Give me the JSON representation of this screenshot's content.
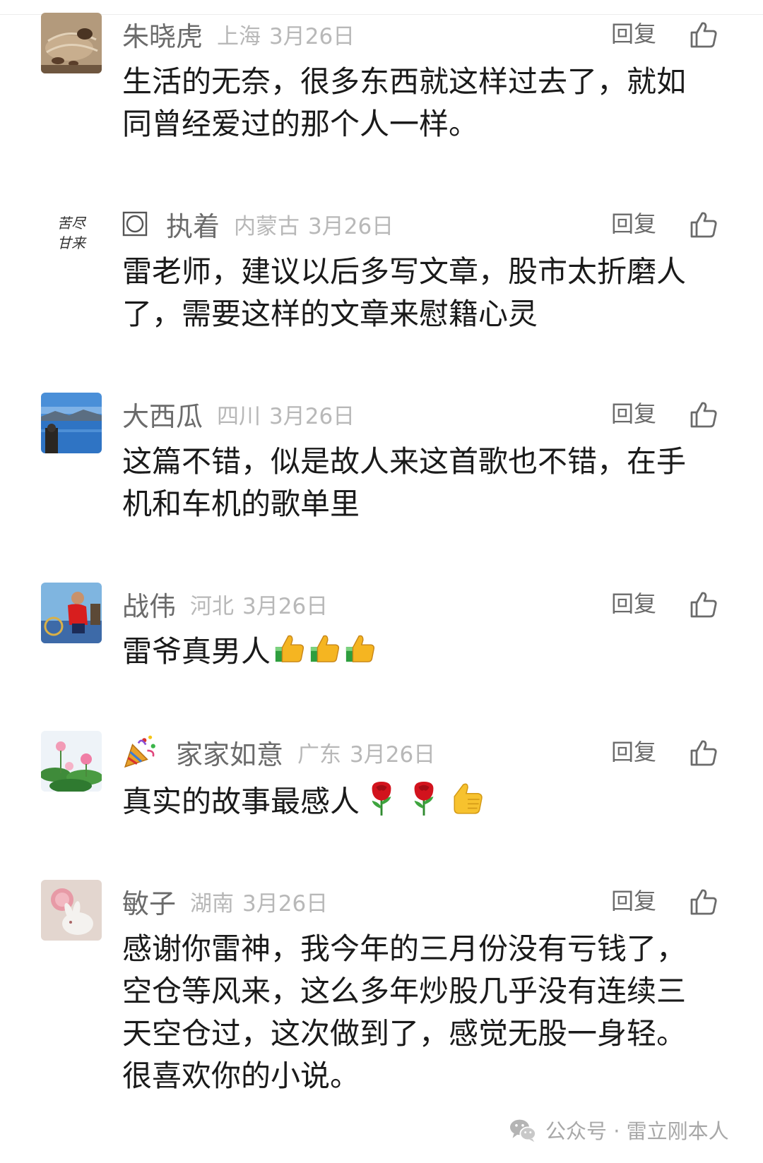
{
  "reply_label": "回复",
  "colors": {
    "name": "#6b6b6b",
    "meta": "#b8b8b8",
    "body": "#1a1a1a"
  },
  "comments": [
    {
      "name": "朱晓虎",
      "location": "上海",
      "date": "3月26日",
      "text": "生活的无奈，很多东西就这样过去了，就如同曾经爱过的那个人一样。",
      "avatar_icon": "tea-set-avatar"
    },
    {
      "prefix_icon": "square-circle-icon",
      "name": "执着",
      "location": "内蒙古",
      "date": "3月26日",
      "text": "雷老师，建议以后多写文章，股市太折磨人了，需要这样的文章来慰籍心灵",
      "avatar_icon": "calligraphy-avatar",
      "avatar_text": "苦尽甘来"
    },
    {
      "name": "大西瓜",
      "location": "四川",
      "date": "3月26日",
      "text": "这篇不错，似是故人来这首歌也不错，在手机和车机的歌单里",
      "avatar_icon": "lake-avatar"
    },
    {
      "name": "战伟",
      "location": "河北",
      "date": "3月26日",
      "text": "雷爷真男人",
      "emojis": [
        "thumbs-up-icon",
        "thumbs-up-icon",
        "thumbs-up-icon"
      ],
      "avatar_icon": "person-red-shirt-avatar"
    },
    {
      "prefix_icon": "party-popper-icon",
      "name": "家家如意",
      "location": "广东",
      "date": "3月26日",
      "text": "真实的故事最感人",
      "emojis": [
        "rose-icon",
        "rose-icon",
        "thumbs-up-icon"
      ],
      "avatar_icon": "lotus-avatar"
    },
    {
      "name": "敏子",
      "location": "湖南",
      "date": "3月26日",
      "text": "感谢你雷神，我今年的三月份没有亏钱了，空仓等风来，这么多年炒股几乎没有连续三天空仓过，这次做到了，感觉无股一身轻。很喜欢你的小说。",
      "avatar_icon": "rabbit-avatar"
    }
  ],
  "watermark": {
    "text": "公众号 · 雷立刚本人",
    "icon": "wechat-icon"
  }
}
